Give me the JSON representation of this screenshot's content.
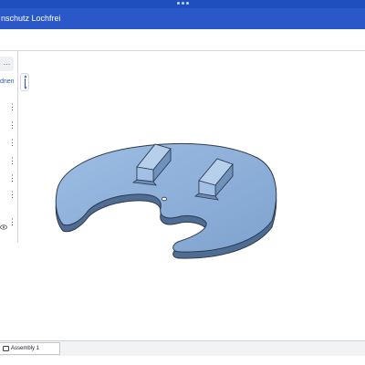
{
  "window": {
    "title": "nschutz Lochfrei"
  },
  "left_panel": {
    "top_button_label": "…",
    "link_label": "dnen",
    "menu_glyph": "⋮",
    "eye_icon": "eye-icon",
    "row_count": 6
  },
  "viewport": {
    "model": "Lochfrei part",
    "model_color": "#8fb1d9"
  },
  "bottom_bar": {
    "tabs": [
      {
        "label": "Assembly 1",
        "icon": "assembly-icon"
      }
    ]
  },
  "colors": {
    "accent": "#2a58c9",
    "model_fill": "#8fb1d9",
    "model_edge": "#2b3a4f"
  }
}
